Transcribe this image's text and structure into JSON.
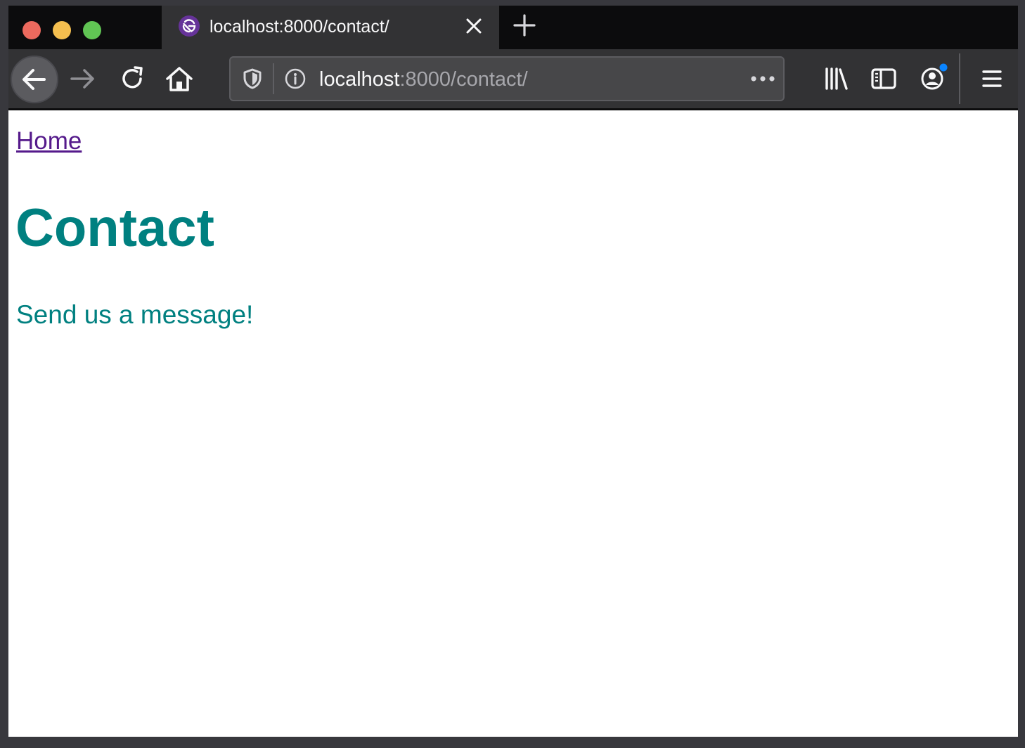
{
  "browser": {
    "tab": {
      "title": "localhost:8000/contact/",
      "favicon": "gatsby-logo-icon"
    },
    "address_bar": {
      "host": "localhost",
      "rest": ":8000/contact/"
    },
    "window_controls": {
      "close_color": "#ed6a5e",
      "minimize_color": "#f5bf4f",
      "maximize_color": "#61c554"
    },
    "toolbar_icons": [
      "back-arrow-icon",
      "forward-arrow-icon",
      "reload-icon",
      "home-icon",
      "library-icon",
      "sidebar-icon",
      "account-icon",
      "hamburger-menu-icon"
    ],
    "notification_dot_color": "#0a84ff"
  },
  "page": {
    "nav": {
      "home_link": "Home"
    },
    "title": "Contact",
    "body_text": "Send us a message!",
    "colors": {
      "heading": "#008080",
      "visited_link": "#551a8b"
    }
  }
}
